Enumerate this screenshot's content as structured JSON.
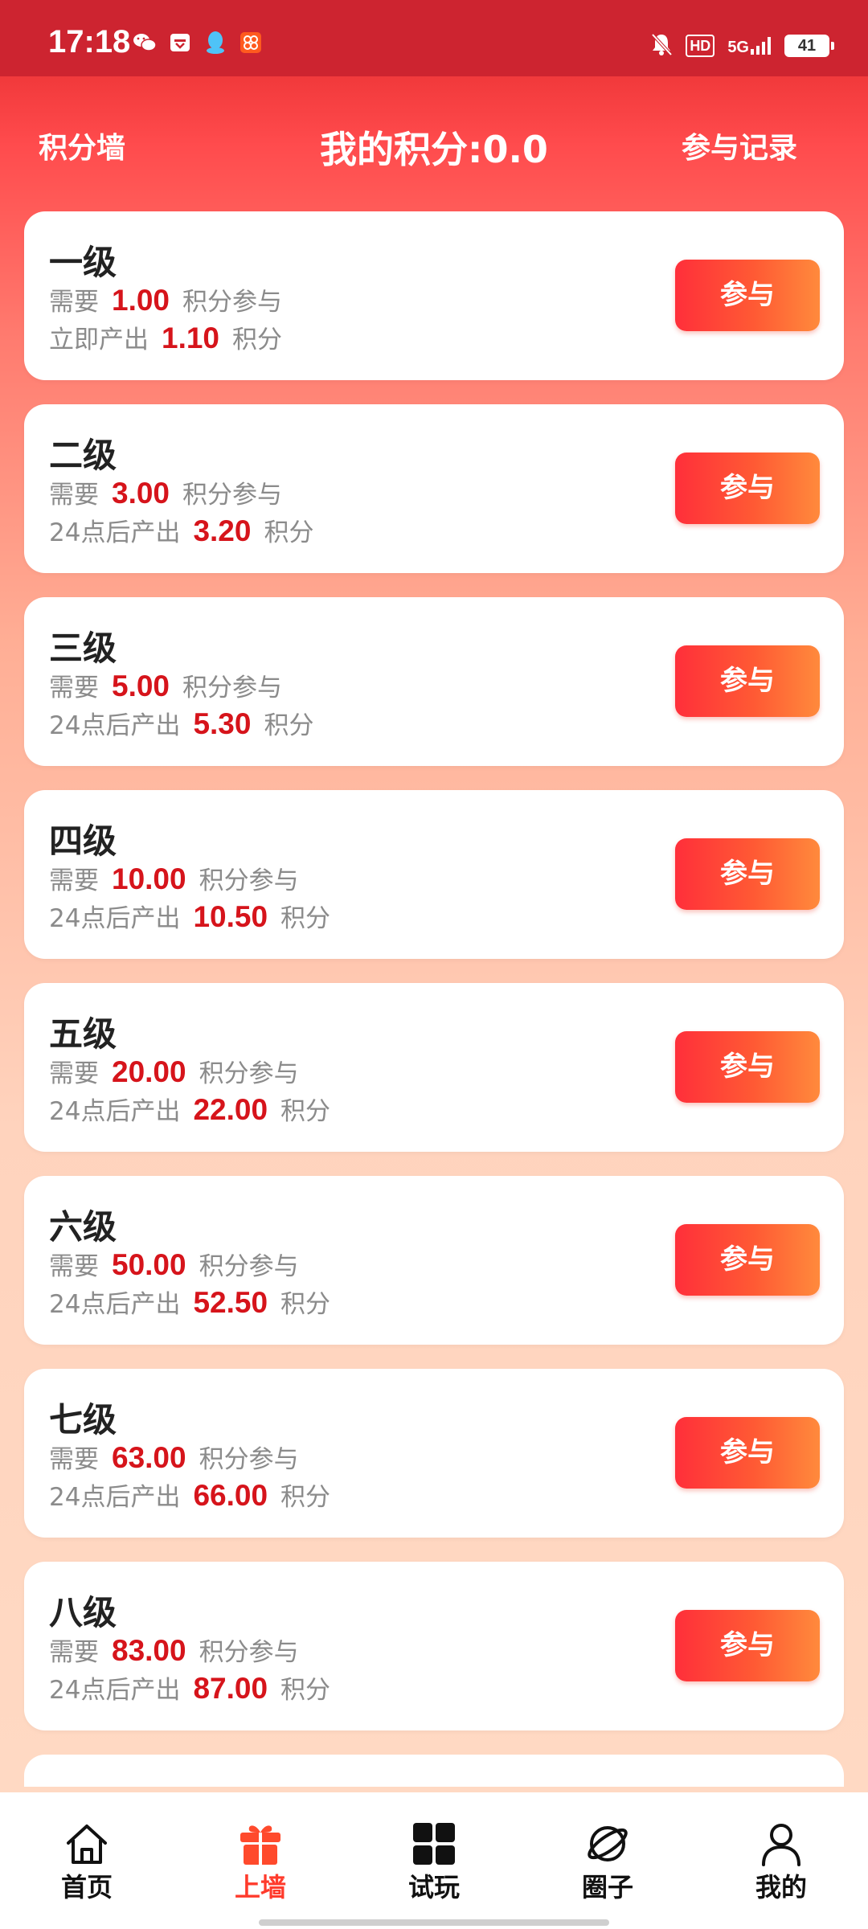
{
  "status_bar": {
    "time": "17:18",
    "hd": "HD",
    "network": "5G",
    "battery": "41"
  },
  "header": {
    "left": "积分墙",
    "title": "我的积分:0.0",
    "right": "参与记录"
  },
  "cards": [
    {
      "level": "一级",
      "need_prefix": "需要",
      "need": "1.00",
      "need_suffix": "积分参与",
      "output_prefix": "立即产出",
      "output": "1.10",
      "output_suffix": "积分",
      "button": "参与"
    },
    {
      "level": "二级",
      "need_prefix": "需要",
      "need": "3.00",
      "need_suffix": "积分参与",
      "output_prefix": "24点后产出",
      "output": "3.20",
      "output_suffix": "积分",
      "button": "参与"
    },
    {
      "level": "三级",
      "need_prefix": "需要",
      "need": "5.00",
      "need_suffix": "积分参与",
      "output_prefix": "24点后产出",
      "output": "5.30",
      "output_suffix": "积分",
      "button": "参与"
    },
    {
      "level": "四级",
      "need_prefix": "需要",
      "need": "10.00",
      "need_suffix": "积分参与",
      "output_prefix": "24点后产出",
      "output": "10.50",
      "output_suffix": "积分",
      "button": "参与"
    },
    {
      "level": "五级",
      "need_prefix": "需要",
      "need": "20.00",
      "need_suffix": "积分参与",
      "output_prefix": "24点后产出",
      "output": "22.00",
      "output_suffix": "积分",
      "button": "参与"
    },
    {
      "level": "六级",
      "need_prefix": "需要",
      "need": "50.00",
      "need_suffix": "积分参与",
      "output_prefix": "24点后产出",
      "output": "52.50",
      "output_suffix": "积分",
      "button": "参与"
    },
    {
      "level": "七级",
      "need_prefix": "需要",
      "need": "63.00",
      "need_suffix": "积分参与",
      "output_prefix": "24点后产出",
      "output": "66.00",
      "output_suffix": "积分",
      "button": "参与"
    },
    {
      "level": "八级",
      "need_prefix": "需要",
      "need": "83.00",
      "need_suffix": "积分参与",
      "output_prefix": "24点后产出",
      "output": "87.00",
      "output_suffix": "积分",
      "button": "参与"
    }
  ],
  "bottom_nav": [
    {
      "label": "首页",
      "icon": "home-icon"
    },
    {
      "label": "上墙",
      "icon": "gift-icon",
      "active": true
    },
    {
      "label": "试玩",
      "icon": "grid-icon"
    },
    {
      "label": "圈子",
      "icon": "planet-icon"
    },
    {
      "label": "我的",
      "icon": "user-icon"
    }
  ],
  "colors": {
    "accent_red": "#d6141b",
    "active_tab": "#ff3b2c",
    "status_bar": "#cd2430"
  }
}
